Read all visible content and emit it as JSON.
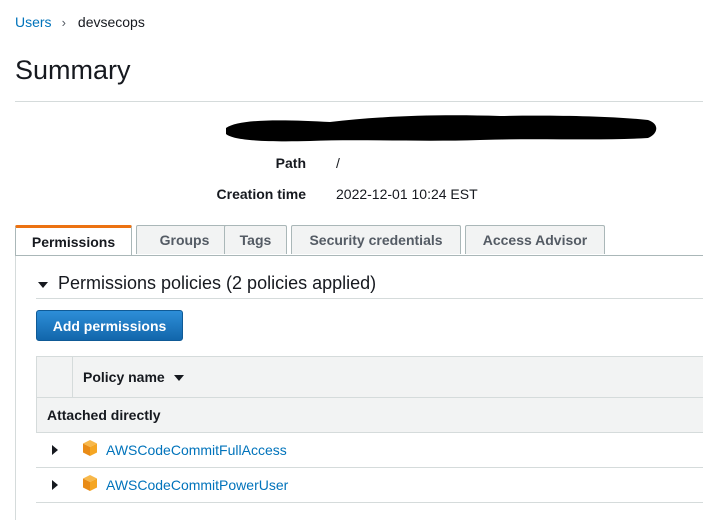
{
  "breadcrumb": {
    "users": "Users",
    "separator": "›",
    "current": "devsecops"
  },
  "page": {
    "title": "Summary"
  },
  "summary": {
    "path_label": "Path",
    "path_value": "/",
    "creation_label": "Creation time",
    "creation_value": "2022-12-01 10:24 EST"
  },
  "tabs": [
    {
      "label": "Permissions",
      "active": true
    },
    {
      "label": "Groups"
    },
    {
      "label": "Tags"
    },
    {
      "label": "Security credentials"
    },
    {
      "label": "Access Advisor"
    }
  ],
  "permissions": {
    "section_title": "Permissions policies (2 policies applied)",
    "add_button": "Add permissions",
    "column_policy_name": "Policy name",
    "group_label": "Attached directly",
    "policies": [
      {
        "name": "AWSCodeCommitFullAccess",
        "icon": "aws-managed-policy-cube-icon"
      },
      {
        "name": "AWSCodeCommitPowerUser",
        "icon": "aws-managed-policy-cube-icon"
      }
    ]
  },
  "colors": {
    "link": "#0073bb",
    "primary_button": "#1a73b8",
    "active_tab_accent": "#ec7211",
    "policy_icon": "#f5a623"
  }
}
